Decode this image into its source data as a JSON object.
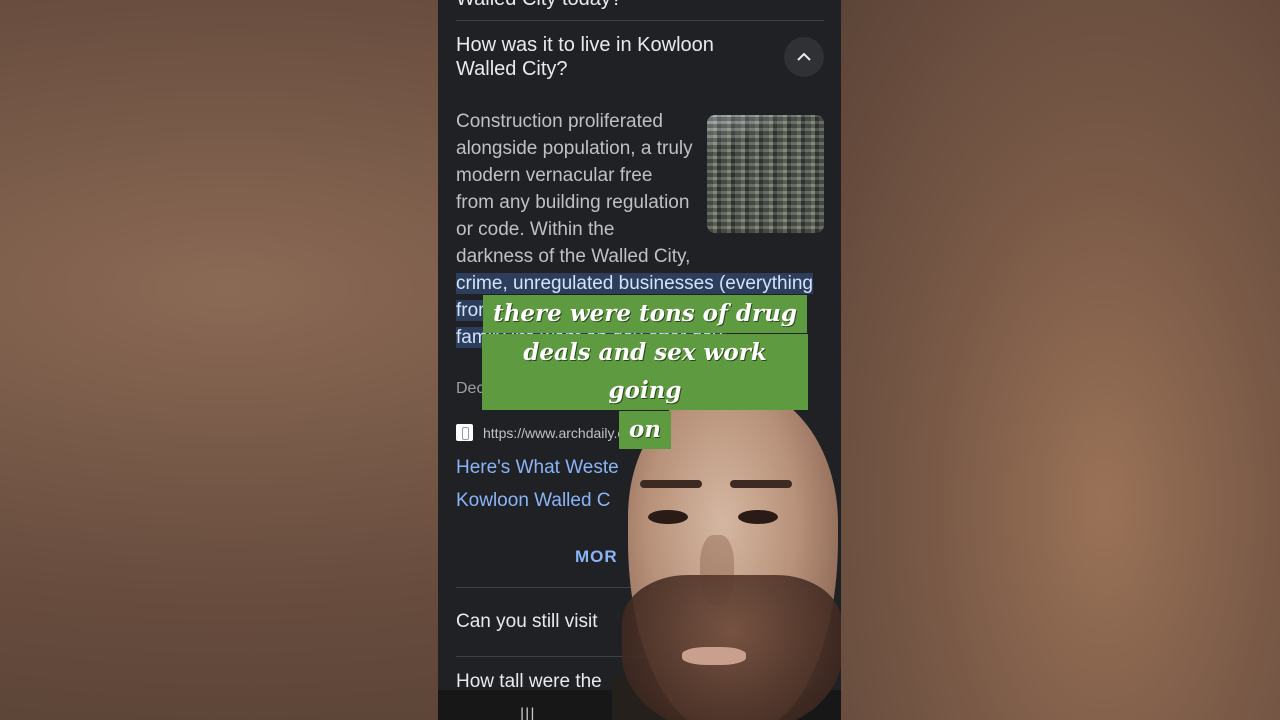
{
  "background": {
    "left_color": "#6b4f40",
    "right_color": "#7a5a47"
  },
  "search": {
    "cut_question": "Walled City today?",
    "open_question": {
      "title": "How was it to live in Kowloon Walled City?",
      "toggle_icon": "chevron-up-icon",
      "answer_plain": "Construction proliferated alongside population, a truly modern vernacular free from any building regulation or code. Within the darkness of the Walled City, ",
      "answer_highlight": "crime, unregulated businesses (everything from ... plastic bags and spring rolls) and family life went on day after day.",
      "date": "Dec 2, 2016",
      "source_url": "https://www.archdaily.c",
      "result_title_line1": "Here's What Weste",
      "result_title_line2": "Kowloon Walled C"
    },
    "more_label": "MOR",
    "other_questions": [
      "Can you still visit",
      "How tall were the"
    ]
  },
  "caption": {
    "line1": "there were tons of drug",
    "line2": "deals and sex work going",
    "line3": "on",
    "bg_color": "#5e9a3f"
  },
  "nav": {
    "recent_apps": "|||"
  }
}
